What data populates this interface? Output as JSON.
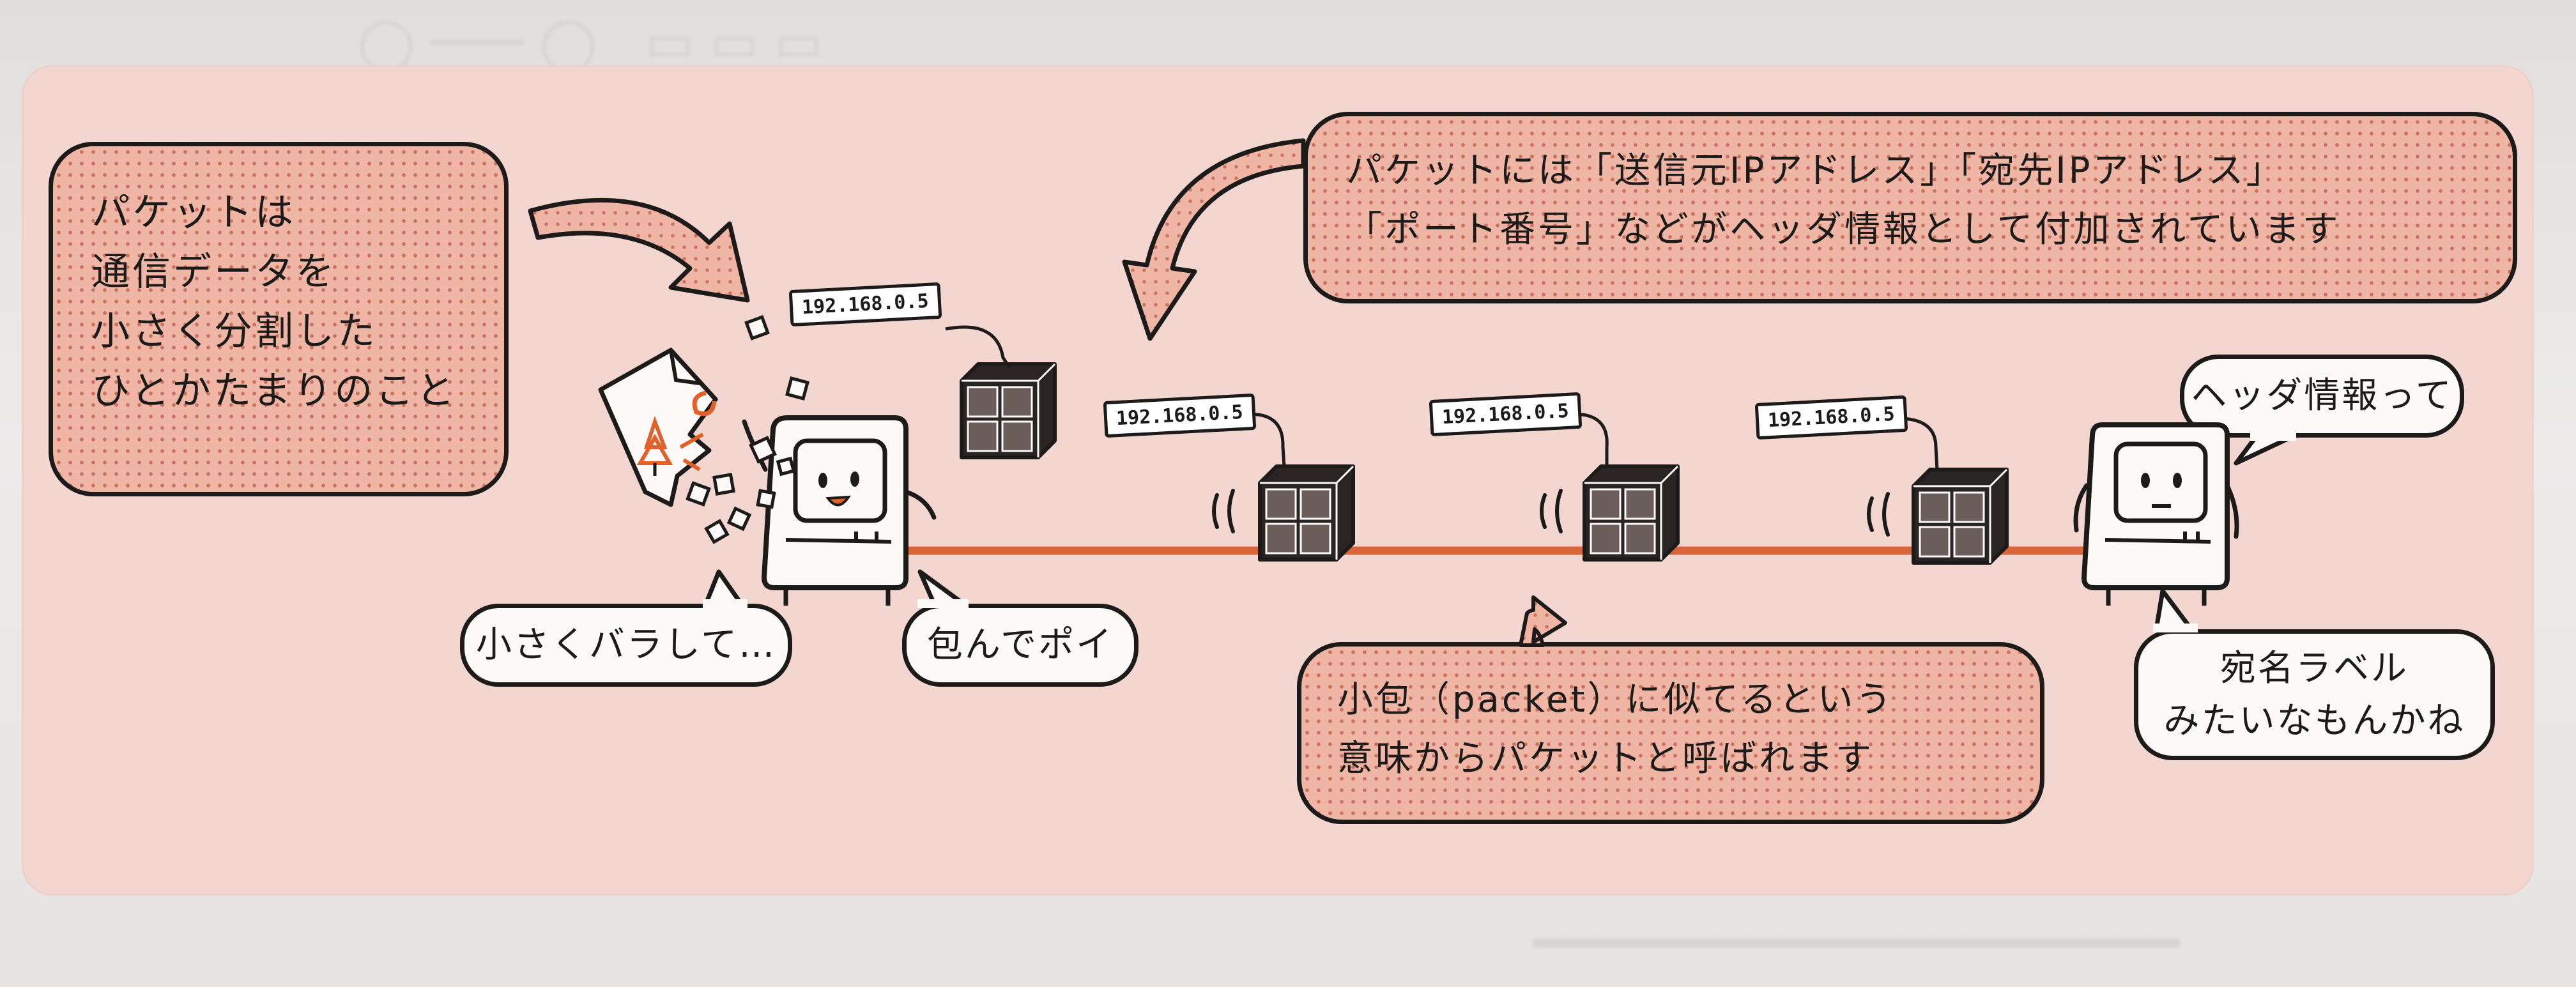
{
  "callouts": {
    "packet_definition": [
      "パケットは",
      "通信データを",
      "小さく分割した",
      "ひとかたまりのこと"
    ],
    "header_info": [
      "パケットには「送信元IPアドレス」「宛先IPアドレス」",
      "「ポート番号」などがヘッダ情報として付加されています"
    ],
    "name_origin": [
      "小包（packet）に似てるという",
      "意味からパケットと呼ばれます"
    ],
    "break_up": "小さくバラして…",
    "wrap_toss": "包んでポイ",
    "header_question": "ヘッダ情報って",
    "label_answer": [
      "宛名ラベル",
      "みたいなもんかね"
    ]
  },
  "packets": [
    {
      "ip_label": "192.168.0.5"
    },
    {
      "ip_label": "192.168.0.5"
    },
    {
      "ip_label": "192.168.0.5"
    },
    {
      "ip_label": "192.168.0.5"
    }
  ],
  "colors": {
    "panel": "#f2d6cf",
    "bubble_fill": "#efb6a6",
    "bubble_dots": "#c9725e",
    "ink": "#1d1a1a",
    "network_line": "#d9663a",
    "accent": "#e2602a"
  }
}
